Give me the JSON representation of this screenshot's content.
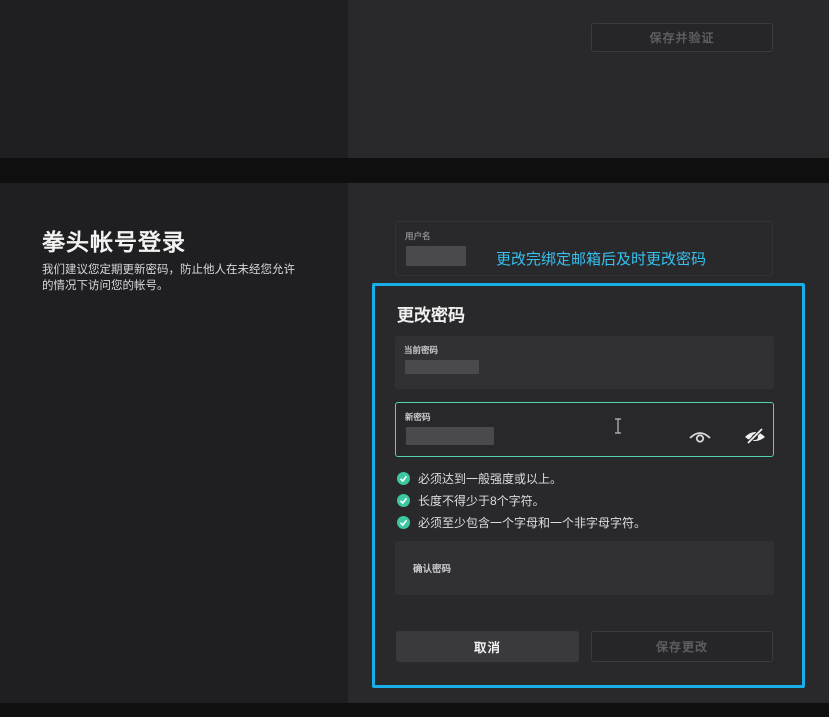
{
  "top_section": {
    "save_verify_label": "保存并验证"
  },
  "riot_login": {
    "title": "拳头帐号登录",
    "description": "我们建议您定期更新密码，防止他人在未经您允许的情况下访问您的帐号。",
    "username_label": "用户名"
  },
  "annotation_text": "更改完绑定邮箱后及时更改密码",
  "change_password": {
    "title": "更改密码",
    "current_password_label": "当前密码",
    "new_password_label": "新密码",
    "confirm_password_label": "确认密码",
    "rules": [
      "必须达到一般强度或以上。",
      "长度不得少于8个字符。",
      "必须至少包含一个字母和一个非字母字符。"
    ],
    "cancel_label": "取消",
    "save_label": "保存更改"
  },
  "colors": {
    "accent_teal": "#4fd3b3",
    "check_green": "#3cc7a0",
    "annotation_blue": "#1aaee8"
  },
  "icons": [
    "eye-icon",
    "eye-off-icon",
    "check-icon",
    "text-cursor-icon"
  ]
}
